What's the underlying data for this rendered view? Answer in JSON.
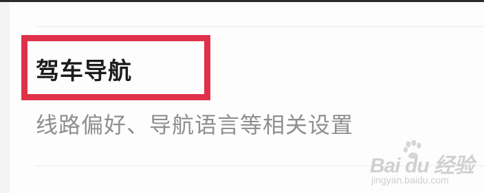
{
  "setting": {
    "title": "驾车导航",
    "description": "线路偏好、导航语言等相关设置"
  },
  "watermark": {
    "brand": "Bai du 经验",
    "url": "jingyan.baidu.com",
    "icon": "baidu-paw-icon"
  },
  "colors": {
    "highlight": "#e0314a",
    "title_text": "#1c1c1c",
    "description_text": "#8e8e8e",
    "divider": "#ececec"
  }
}
